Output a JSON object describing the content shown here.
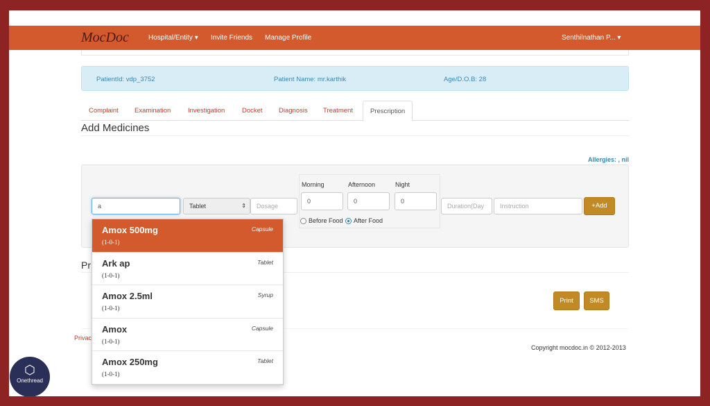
{
  "nav": {
    "logo": "MocDoc",
    "links": [
      "Hospital/Entity ▾",
      "Invite Friends",
      "Manage Profile"
    ],
    "user": "Senthilnathan P... ▾"
  },
  "patient": {
    "id": "PatientId: vdp_3752",
    "name": "Patient Name: mr.karthik",
    "age": "Age/D.O.B: 28"
  },
  "tabs": [
    "Complaint",
    "Examination",
    "Investigation",
    "Docket",
    "Diagnosis",
    "Treatment",
    "Prescription"
  ],
  "active_tab": "Prescription",
  "section_title": "Add Medicines",
  "allergies": "Allergies: , nil",
  "form": {
    "medicine_value": "a",
    "type_value": "Tablet",
    "dosage_placeholder": "Dosage",
    "morning_label": "Morning",
    "afternoon_label": "Afternoon",
    "night_label": "Night",
    "morning": "0",
    "afternoon": "0",
    "night": "0",
    "before_food": "Before Food",
    "after_food": "After Food",
    "food_selected": "After Food",
    "duration_placeholder": "Duration(Day",
    "instruction_placeholder": "Instruction",
    "add_label": "+Add"
  },
  "prescription_title": "Pr",
  "print_label": "Print",
  "sms_label": "SMS",
  "privacy": "Privac",
  "copyright": "Copyright mocdoc.in © 2012-2013",
  "suggestions": [
    {
      "name": "Amox 500mg",
      "dose": "(1-0-1)",
      "type": "Capsule"
    },
    {
      "name": "Ark ap",
      "dose": "(1-0-1)",
      "type": "Tablet"
    },
    {
      "name": "Amox 2.5ml",
      "dose": "(1-0-1)",
      "type": "Syrup"
    },
    {
      "name": "Amox",
      "dose": "(1-0-1)",
      "type": "Capsule"
    },
    {
      "name": "Amox 250mg",
      "dose": "(1-0-1)",
      "type": "Tablet"
    }
  ],
  "watermark": "Onethread",
  "colors": {
    "nav": "#d25a2c",
    "frame": "#8e2323",
    "button": "#c18a27",
    "info": "#d9edf7"
  }
}
